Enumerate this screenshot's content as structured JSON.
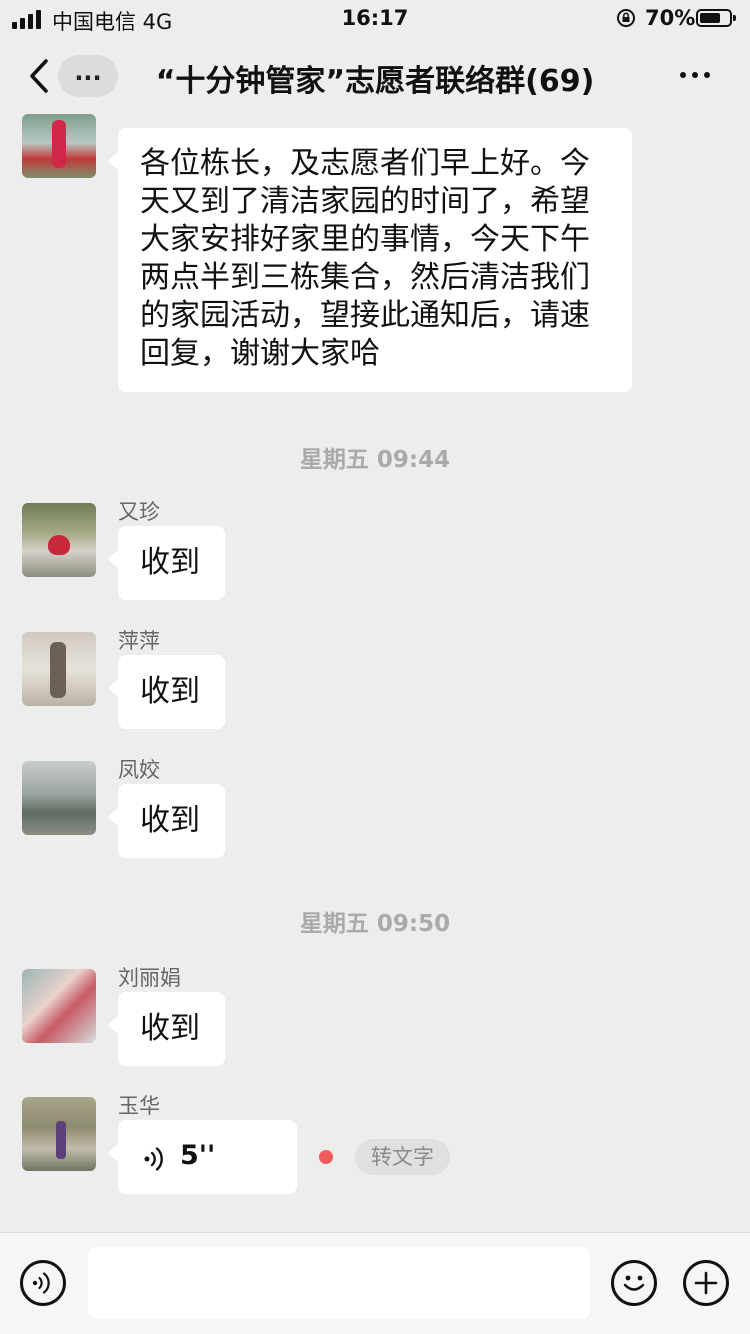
{
  "status": {
    "carrier": "中国电信  4G",
    "time": "16:17",
    "battery_pct": "70%",
    "battery_level": 0.7
  },
  "nav": {
    "more_pill": "...",
    "title": "“十分钟管家”志愿者联络群(69)"
  },
  "messages": {
    "m0": {
      "text": "各位栋长，及志愿者们早上好。今天又到了清洁家园的时间了，希望大家安排好家里的事情，今天下午两点半到三栋集合，然后清洁我们的家园活动，望接此通知后，请速回复，谢谢大家哈"
    },
    "ts1": "星期五 09:44",
    "m1": {
      "sender": "又珍",
      "text": "收到"
    },
    "m2": {
      "sender": "萍萍",
      "text": "收到"
    },
    "m3": {
      "sender": "凤姣",
      "text": "收到"
    },
    "ts2": "星期五 09:50",
    "m4": {
      "sender": "刘丽娟",
      "text": "收到"
    },
    "m5": {
      "sender": "玉华",
      "voice_duration": "5''",
      "to_text": "转文字"
    }
  },
  "colors": {
    "background": "#ededed",
    "bubble": "#ffffff",
    "unread_dot": "#f05b5b",
    "timestamp": "#aaaaaa"
  },
  "icons": {
    "voice_mode": "voice-mode-icon",
    "emoji": "emoji-icon",
    "plus": "plus-icon",
    "back": "chevron-left-icon",
    "menu": "more-dots-icon"
  }
}
